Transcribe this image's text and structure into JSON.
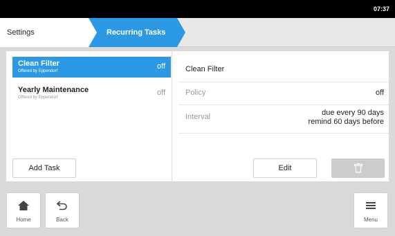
{
  "status_bar": {
    "time": "07:37"
  },
  "breadcrumb": {
    "items": [
      {
        "label": "Settings"
      },
      {
        "label": "Recurring Tasks"
      }
    ]
  },
  "tasks": [
    {
      "name": "Clean Filter",
      "sub": "Offered by Eppendorf",
      "status": "off",
      "selected": true
    },
    {
      "name": "Yearly Maintenance",
      "sub": "Offered by Eppendorf",
      "status": "off",
      "selected": false
    }
  ],
  "add_task_label": "Add Task",
  "detail": {
    "title": "Clean Filter",
    "policy_label": "Policy",
    "policy_value": "off",
    "interval_label": "Interval",
    "interval_line1": "due every 90 days",
    "interval_line2": "remind 60 days before"
  },
  "edit_label": "Edit",
  "icons": {
    "delete": "trash-icon",
    "home": "home-icon",
    "back": "back-arrow-icon",
    "menu": "menu-icon"
  },
  "colors": {
    "accent": "#2b99e3",
    "disabled": "#cccccc"
  },
  "bottom_nav": {
    "home_label": "Home",
    "back_label": "Back",
    "menu_label": "Menu"
  }
}
